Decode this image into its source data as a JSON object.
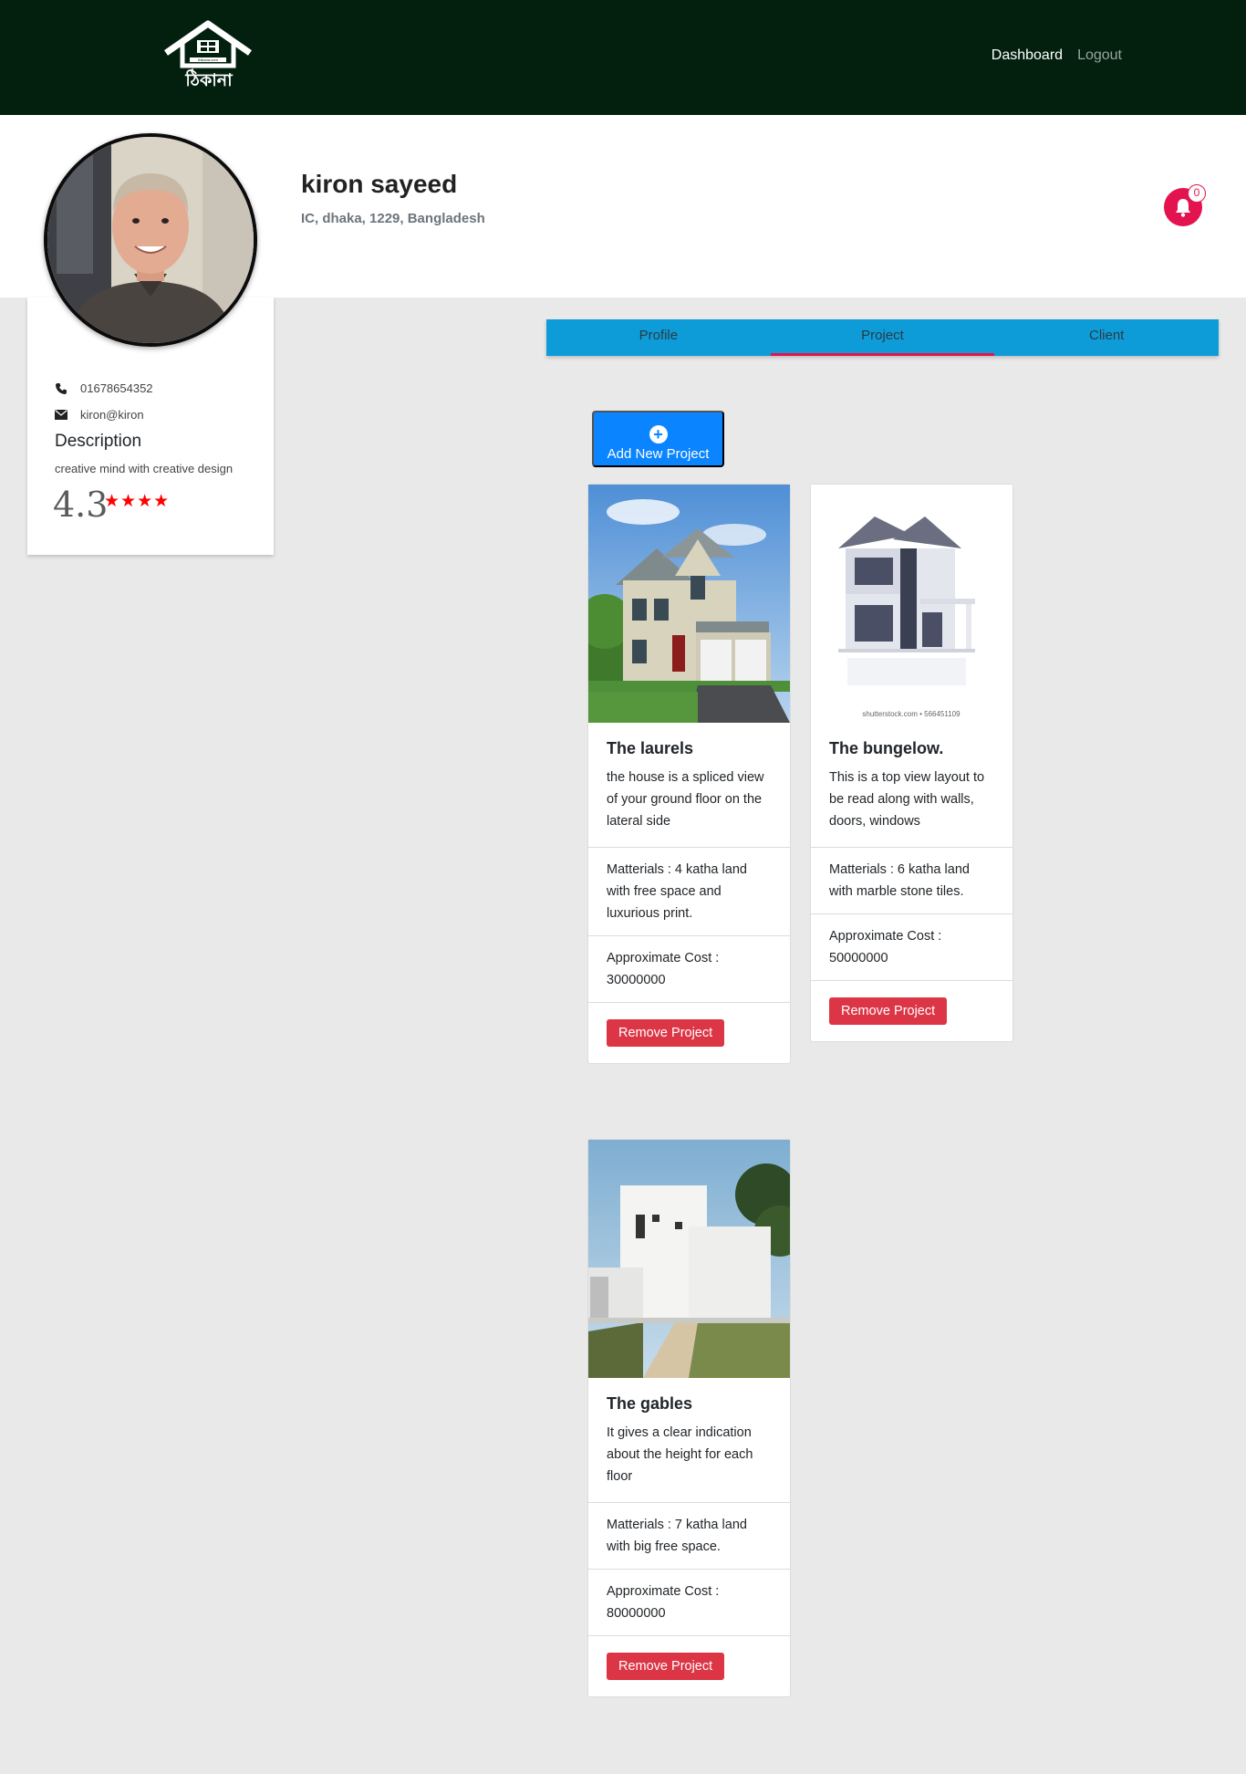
{
  "nav": {
    "brand": "ঠিকানা",
    "brand_small": "thikana.com",
    "dashboard": "Dashboard",
    "logout": "Logout"
  },
  "profile": {
    "name": "kiron sayeed",
    "address": "IC, dhaka, 1229,  Bangladesh",
    "phone": "01678654352",
    "email": "kiron@kiron",
    "description_title": "Description",
    "description": "creative mind with creative design",
    "rating": "4.3",
    "stars": "★★★★",
    "notification_count": "0"
  },
  "tabs": [
    {
      "label": "Profile"
    },
    {
      "label": "Project",
      "active": true
    },
    {
      "label": "Client"
    }
  ],
  "add_button": {
    "label": "Add New Project"
  },
  "projects": [
    {
      "title": "The laurels",
      "description": "the house is a spliced view of your ground floor on the lateral side",
      "materials": "Matterials : 4 katha land with free space and luxurious print.",
      "cost": "Approximate Cost : 30000000",
      "remove_label": "Remove Project"
    },
    {
      "title": "The bungelow.",
      "description": "This is a top view layout to be read along with walls, doors, windows",
      "materials": "Matterials : 6 katha land with marble stone tiles.",
      "cost": "Approximate Cost : 50000000",
      "remove_label": "Remove Project",
      "image_caption": "shutterstock.com • 566451109"
    },
    {
      "title": "The gables",
      "description": "It gives a clear indication about the height for each floor",
      "materials": "Matterials : 7 katha land with big free space.",
      "cost": "Approximate Cost : 80000000",
      "remove_label": "Remove Project"
    }
  ],
  "colors": {
    "nav_bg": "#03200f",
    "tab_bar": "#0d9cd8",
    "accent_pink": "#e2134e",
    "add_button": "#0a84ff",
    "remove_button": "#dc3545",
    "star": "#ff0000"
  }
}
